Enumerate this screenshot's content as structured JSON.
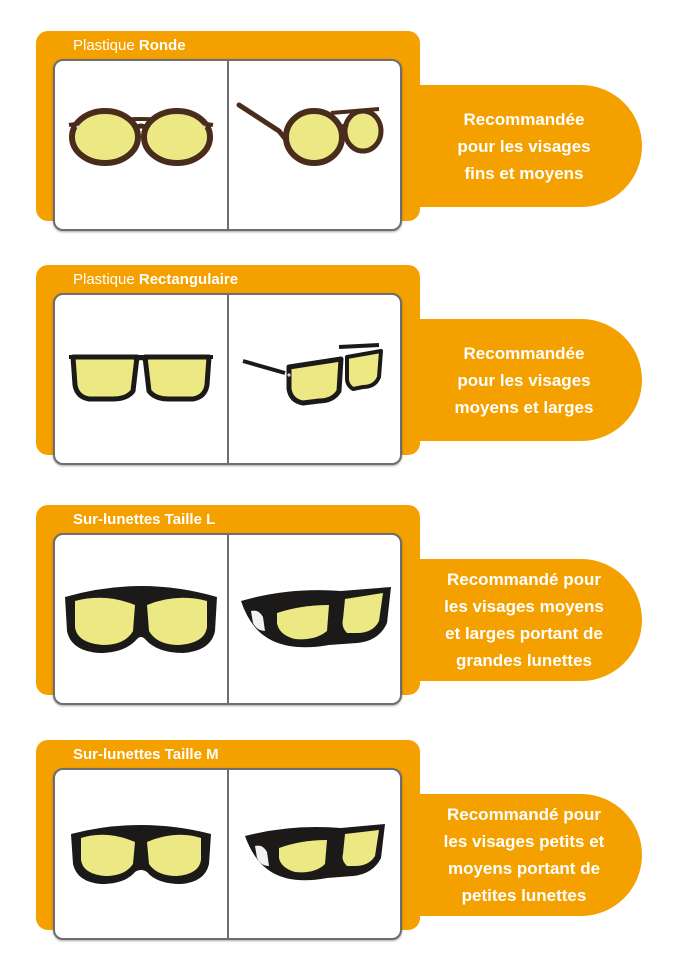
{
  "products": [
    {
      "title_prefix": "Plastique ",
      "title_bold": "Ronde",
      "front_icon": "round-glasses-front",
      "side_icon": "round-glasses-side",
      "recommendation_lines": [
        "Recommandée",
        "pour les visages",
        "fins et moyens"
      ]
    },
    {
      "title_prefix": "Plastique ",
      "title_bold": "Rectangulaire",
      "front_icon": "rectangular-glasses-front",
      "side_icon": "rectangular-glasses-side",
      "recommendation_lines": [
        "Recommandée",
        "pour les visages",
        "moyens et larges"
      ]
    },
    {
      "title_prefix": "",
      "title_bold": "Sur-lunettes Taille L",
      "front_icon": "overglasses-l-front",
      "side_icon": "overglasses-l-side",
      "recommendation_lines": [
        "Recommandé pour",
        "les visages moyens",
        "et larges portant de",
        "grandes lunettes"
      ]
    },
    {
      "title_prefix": "",
      "title_bold": "Sur-lunettes Taille M",
      "front_icon": "overglasses-m-front",
      "side_icon": "overglasses-m-side",
      "recommendation_lines": [
        "Recommandé pour",
        "les visages petits et",
        "moyens portant de",
        "petites lunettes"
      ]
    }
  ],
  "colors": {
    "accent": "#f4a100",
    "lens": "#ece884",
    "frame": "#1c1a18",
    "tortoise_frame": "#4a2c1c",
    "photo_border": "#6e6e6e"
  }
}
